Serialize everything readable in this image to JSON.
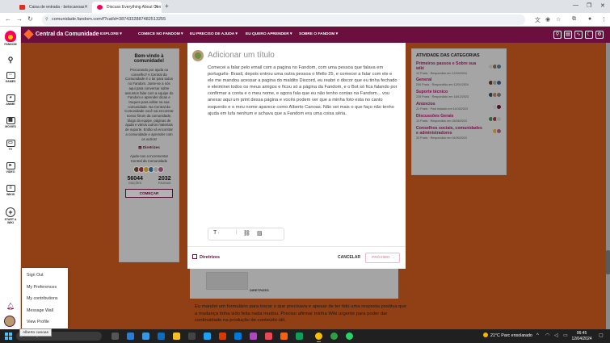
{
  "browser": {
    "tabs": [
      {
        "title": "Caixa de entrada - betocanoas",
        "favicon_color": "#d93025"
      },
      {
        "title": "Discuss Everything About Cen",
        "favicon_color": "#fa005a"
      }
    ],
    "url": "comunidade.fandom.com/f?catId=3874332887482513255"
  },
  "rail": {
    "items": [
      {
        "label": "FANDOM",
        "icon": "fandom-logo-icon"
      },
      {
        "label": "",
        "icon": "search-icon"
      },
      {
        "label": "GAMES",
        "icon": "gamepad-icon"
      },
      {
        "label": "ANIME",
        "icon": "anime-icon"
      },
      {
        "label": "MOVIES",
        "icon": "film-icon"
      },
      {
        "label": "TV",
        "icon": "tv-icon"
      },
      {
        "label": "VIDEO",
        "icon": "play-icon"
      },
      {
        "label": "WIKIS",
        "icon": "wikis-icon"
      },
      {
        "label": "START A WIKI",
        "icon": "plus-icon"
      }
    ]
  },
  "header": {
    "title": "Central da Comunidade",
    "nav": [
      "EXPLORE ▾",
      "COMECE NO FANDOM ▾",
      "EU PRECISO DE AJUDA ▾",
      "EU QUERO APRENDER ▾",
      "SOBRE O FANDOM ▾"
    ],
    "accent": "#6b0f3f"
  },
  "left_panel": {
    "title": "Bem-vindo à comunidade!",
    "text": "Procurando por ajuda ou conselho? A Central da Comunidade é o lar para todos no Fandom. Junte-se a nós aqui para conversar sobre assuntos falar com a equipe do Fandom e aprender dicas e truques para editar na sua comunidade. Na Central da Comunidade você vai encontrar nosso fórum da comunidade, blogs da equipe, páginas de ajuda e vários outros materiais de suporte. Então vá encontrar a comunidade e aprender com os outros!",
    "link": "Diretrizes",
    "ask": "Ajude-nos a Incrementar Central da Comunidade",
    "stats": [
      {
        "value": "56044",
        "label": "EDIÇÕES"
      },
      {
        "value": "2032",
        "label": "PÁGINAS"
      }
    ],
    "button": "COMEÇAR"
  },
  "right_panel": {
    "title": "ATIVIDADE DAS CATEGORIAS",
    "categories": [
      {
        "name": "Primeiros passos e Sobre sua wiki",
        "meta": "12 Posts · Respondido em 12/04/2024"
      },
      {
        "name": "General",
        "meta": "200 Posts · Respondido em 12/01/2024"
      },
      {
        "name": "Suporte técnico",
        "meta": "228 Posts · Respondido em 18/12/2023"
      },
      {
        "name": "Anúncios",
        "meta": "21 Posts · Post iniciado em 11/03/2023"
      },
      {
        "name": "Discussões Gerais",
        "meta": "13 Posts · Respondido em 28/08/2023"
      },
      {
        "name": "Conselhos sociais, comunidades e administradores",
        "meta": "33 Posts · Respondido em 04/09/2023"
      }
    ]
  },
  "modal": {
    "title_placeholder": "Adicionar um título",
    "body": "Comecei a falar pelo email com a pagina no Fandom, com uma pessoa que falava em português- Brasil, depois entrou uma outra pessoa o   Mello 25, e comecei a falar com ele e ele  me mandou acessar a pagina do maldito Discord, eu reabri o discor que eu tinha fechado e eleiminei todos os meus amigos e ficou só a página da Fandom, e  o Bot só fica falando por confirmar a conta e o meu nome,  e  agora fala que eu não tenho contas  na Fandom... vou anexar aqui um print dessa página e vocês podem ver que a minha foto esta no canto esquerdo  e o meu nome aparece como Alberto Canoas.  Não sei mais o que faço não tenho ajuda em lufa nenhum e achava que a Fandom era uma coisa séria.",
    "guidelines": "Diretrizes",
    "cancel": "CANCELAR",
    "next": "PRÓXIMO →"
  },
  "under_post": {
    "tag": "DIRETRIZES",
    "text": "Eu mandei um formulário para tracar o que precisava e apesar de ter tido uma resposta positiva que a mudança tinha sido feita nada mudou. Preciso afirmar minha Wiki urgente para poder dar continuidade na produção de conteúdo útil."
  },
  "user_menu": {
    "items": [
      "Sign Out",
      "My Preferences",
      "My contributions",
      "Message Wall",
      "View Profile"
    ],
    "tooltip": "Alberto canoas"
  },
  "taskbar": {
    "search": "Pesquisar",
    "weather": "21°C  Parc ensolarado",
    "time": "06:45",
    "date": "12/04/2024"
  }
}
